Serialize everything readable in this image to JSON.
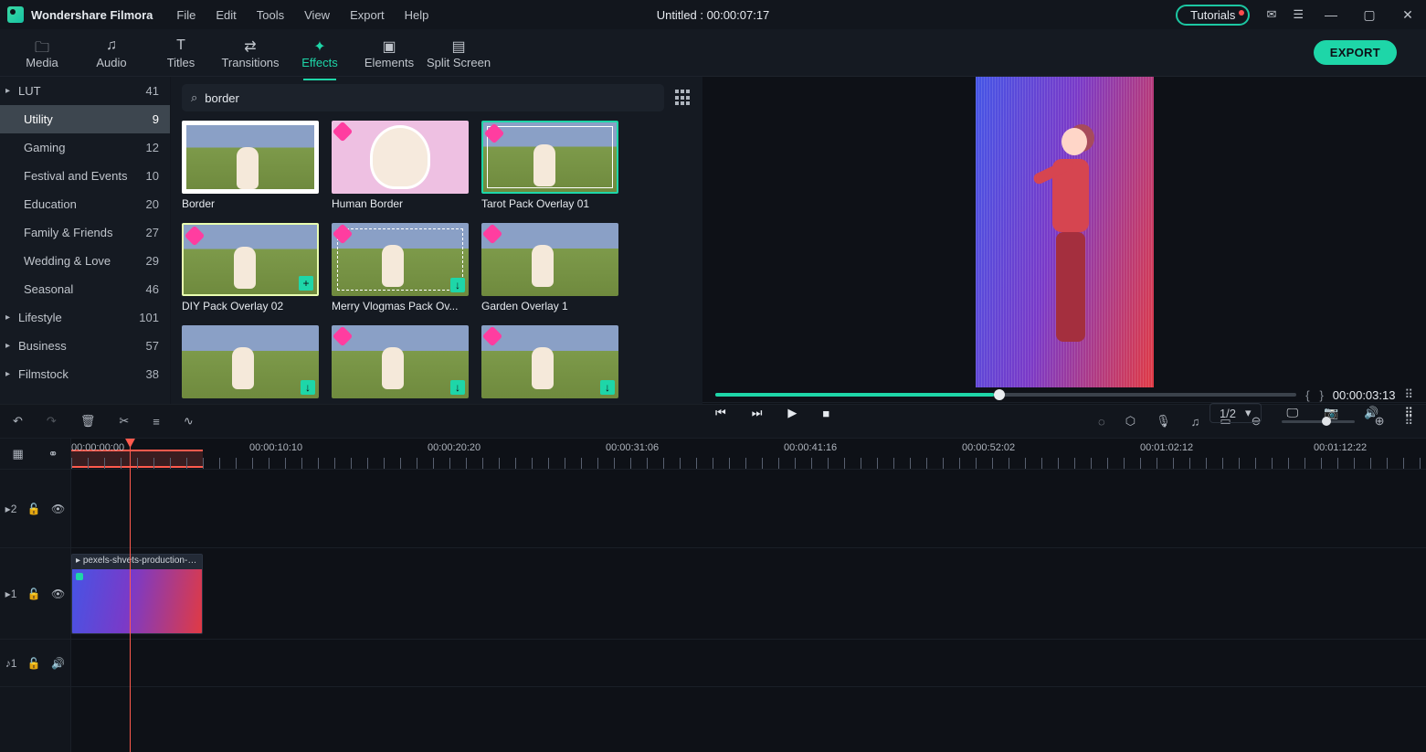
{
  "title_bar": {
    "brand": "Wondershare Filmora",
    "menus": [
      "File",
      "Edit",
      "Tools",
      "View",
      "Export",
      "Help"
    ],
    "project_title": "Untitled : 00:00:07:17",
    "tutorials_label": "Tutorials"
  },
  "ribbon": {
    "tabs": [
      {
        "label": "Media",
        "icon": "folder-icon"
      },
      {
        "label": "Audio",
        "icon": "music-icon"
      },
      {
        "label": "Titles",
        "icon": "text-icon"
      },
      {
        "label": "Transitions",
        "icon": "transition-icon"
      },
      {
        "label": "Effects",
        "icon": "sparkle-icon",
        "active": true
      },
      {
        "label": "Elements",
        "icon": "shapes-icon"
      },
      {
        "label": "Split Screen",
        "icon": "splitscreen-icon"
      }
    ],
    "export_label": "EXPORT"
  },
  "sidebar": {
    "categories": [
      {
        "label": "LUT",
        "count": 41,
        "heading": true,
        "expandable": true
      },
      {
        "label": "Utility",
        "count": 9,
        "selected": true
      },
      {
        "label": "Gaming",
        "count": 12
      },
      {
        "label": "Festival and Events",
        "count": 10
      },
      {
        "label": "Education",
        "count": 20
      },
      {
        "label": "Family & Friends",
        "count": 27
      },
      {
        "label": "Wedding & Love",
        "count": 29
      },
      {
        "label": "Seasonal",
        "count": 46
      },
      {
        "label": "Lifestyle",
        "count": 101,
        "heading": true,
        "expandable": true
      },
      {
        "label": "Business",
        "count": 57,
        "heading": true,
        "expandable": true
      },
      {
        "label": "Filmstock",
        "count": 38,
        "heading": true,
        "expandable": true
      }
    ]
  },
  "search": {
    "placeholder": "Search",
    "value": "border"
  },
  "effects": [
    {
      "label": "Border",
      "style": "th-vineyard th-border1"
    },
    {
      "label": "Human Border",
      "style": "th-pink",
      "premium": true
    },
    {
      "label": "Tarot Pack Overlay 01",
      "style": "th-vineyard th-tarot",
      "premium": true,
      "selected": true
    },
    {
      "label": "DIY Pack Overlay 02",
      "style": "th-vineyard th-diy",
      "premium": true,
      "downloadable": true,
      "add": true
    },
    {
      "label": "Merry Vlogmas Pack Ov...",
      "style": "th-vineyard th-merry",
      "premium": true,
      "downloadable": true
    },
    {
      "label": "Garden Overlay 1",
      "style": "th-vineyard",
      "premium": true
    },
    {
      "label": "",
      "style": "th-vineyard",
      "downloadable": true
    },
    {
      "label": "",
      "style": "th-vineyard",
      "premium": true,
      "downloadable": true
    },
    {
      "label": "",
      "style": "th-vineyard",
      "premium": true,
      "downloadable": true
    }
  ],
  "preview": {
    "ratio": "1/2",
    "brackets_left": "{",
    "brackets_right": "}",
    "timecode": "00:00:03:13",
    "progress_pct": 48
  },
  "timeline": {
    "ruler": [
      {
        "pos": 0,
        "label": "00:00:00:00"
      },
      {
        "pos": 195,
        "label": "00:00:10:10"
      },
      {
        "pos": 390,
        "label": "00:00:20:20"
      },
      {
        "pos": 585,
        "label": "00:00:31:06"
      },
      {
        "pos": 780,
        "label": "00:00:41:16"
      },
      {
        "pos": 975,
        "label": "00:00:52:02"
      },
      {
        "pos": 1170,
        "label": "00:01:02:12"
      },
      {
        "pos": 1360,
        "label": "00:01:12:22"
      }
    ],
    "tracks": [
      {
        "id": "2",
        "type": "video"
      },
      {
        "id": "1",
        "type": "video"
      },
      {
        "id": "1",
        "type": "audio"
      }
    ],
    "clip_label": "pexels-shvets-production-7…"
  }
}
